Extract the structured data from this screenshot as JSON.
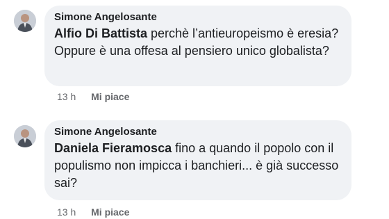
{
  "comments": [
    {
      "author": "Simone Angelosante",
      "mention": "Alfio Di Battista",
      "text": " perchè l’antieuropeismo è eresia? Oppure è una offesa al pensiero unico globalista?",
      "time": "13 h",
      "like_label": "Mi piace"
    },
    {
      "author": "Simone Angelosante",
      "mention": "Daniela Fieramosca",
      "text": " fino a quando il popolo con il populismo non impicca i banchieri... è già successo sai?",
      "time": "13 h",
      "like_label": "Mi piace"
    }
  ]
}
